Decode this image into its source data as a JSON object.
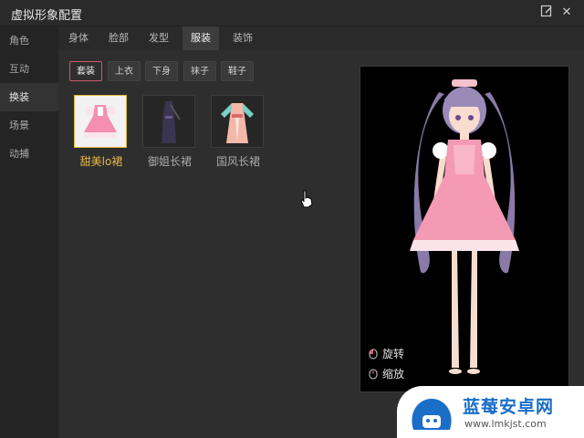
{
  "window": {
    "title": "虚拟形象配置"
  },
  "titlebar": {
    "edit_icon": "edit-icon",
    "close_glyph": "✕"
  },
  "sidebar": {
    "items": [
      {
        "label": "角色",
        "active": false
      },
      {
        "label": "互动",
        "active": false
      },
      {
        "label": "换装",
        "active": true
      },
      {
        "label": "场景",
        "active": false
      },
      {
        "label": "动捕",
        "active": false
      }
    ]
  },
  "tabs": [
    {
      "label": "身体"
    },
    {
      "label": "脸部"
    },
    {
      "label": "发型"
    },
    {
      "label": "服装",
      "active": true
    },
    {
      "label": "装饰"
    }
  ],
  "subtabs": [
    {
      "label": "套装",
      "active": true
    },
    {
      "label": "上衣"
    },
    {
      "label": "下身"
    },
    {
      "label": "袜子"
    },
    {
      "label": "鞋子"
    }
  ],
  "outfits": [
    {
      "label": "甜美lo裙",
      "selected": true
    },
    {
      "label": "御姐长裙",
      "selected": false
    },
    {
      "label": "国风长裙",
      "selected": false
    }
  ],
  "preview": {
    "rotate_label": "旋转",
    "zoom_label": "缩放"
  },
  "watermark": {
    "text": "蓝莓安卓网",
    "url": "www.lmkjst.com"
  },
  "colors": {
    "accent_selected": "#e2b93b",
    "chip_active_border": "#d05a6e",
    "watermark_blue": "#1a6ec8"
  }
}
